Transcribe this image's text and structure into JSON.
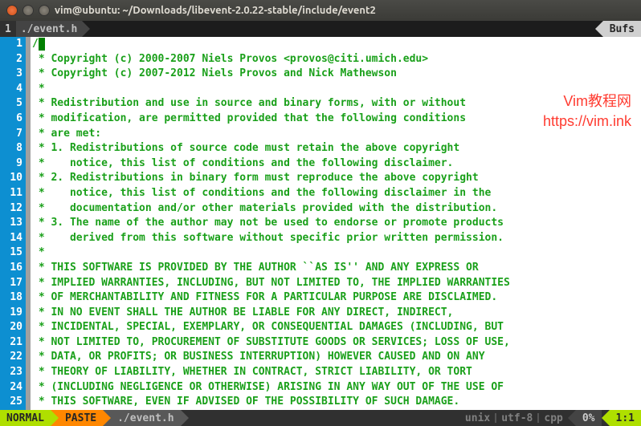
{
  "window": {
    "title": "vim@ubuntu: ~/Downloads/libevent-2.0.22-stable/include/event2"
  },
  "tabline": {
    "index": "1",
    "filepath": "./event.h",
    "bufs_label": "Bufs"
  },
  "watermark": {
    "line1": "Vim教程网",
    "line2": "https://vim.ink"
  },
  "code": {
    "lines": [
      "*",
      " * Copyright (c) 2000-2007 Niels Provos <provos@citi.umich.edu>",
      " * Copyright (c) 2007-2012 Niels Provos and Nick Mathewson",
      " *",
      " * Redistribution and use in source and binary forms, with or without",
      " * modification, are permitted provided that the following conditions",
      " * are met:",
      " * 1. Redistributions of source code must retain the above copyright",
      " *    notice, this list of conditions and the following disclaimer.",
      " * 2. Redistributions in binary form must reproduce the above copyright",
      " *    notice, this list of conditions and the following disclaimer in the",
      " *    documentation and/or other materials provided with the distribution.",
      " * 3. The name of the author may not be used to endorse or promote products",
      " *    derived from this software without specific prior written permission.",
      " *",
      " * THIS SOFTWARE IS PROVIDED BY THE AUTHOR ``AS IS'' AND ANY EXPRESS OR",
      " * IMPLIED WARRANTIES, INCLUDING, BUT NOT LIMITED TO, THE IMPLIED WARRANTIES",
      " * OF MERCHANTABILITY AND FITNESS FOR A PARTICULAR PURPOSE ARE DISCLAIMED.",
      " * IN NO EVENT SHALL THE AUTHOR BE LIABLE FOR ANY DIRECT, INDIRECT,",
      " * INCIDENTAL, SPECIAL, EXEMPLARY, OR CONSEQUENTIAL DAMAGES (INCLUDING, BUT",
      " * NOT LIMITED TO, PROCUREMENT OF SUBSTITUTE GOODS OR SERVICES; LOSS OF USE,",
      " * DATA, OR PROFITS; OR BUSINESS INTERRUPTION) HOWEVER CAUSED AND ON ANY",
      " * THEORY OF LIABILITY, WHETHER IN CONTRACT, STRICT LIABILITY, OR TORT",
      " * (INCLUDING NEGLIGENCE OR OTHERWISE) ARISING IN ANY WAY OUT OF THE USE OF",
      " * THIS SOFTWARE, EVEN IF ADVISED OF THE POSSIBILITY OF SUCH DAMAGE."
    ]
  },
  "status": {
    "mode": "NORMAL",
    "paste": "PASTE",
    "file": "./event.h",
    "eol": "unix",
    "enc": "utf-8",
    "ft": "cpp",
    "percent": "0%",
    "pos": "1:1"
  }
}
